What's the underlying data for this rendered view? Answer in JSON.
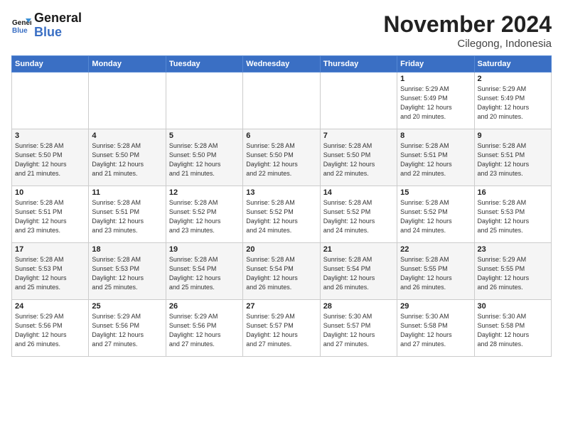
{
  "header": {
    "logo_line1": "General",
    "logo_line2": "Blue",
    "month": "November 2024",
    "location": "Cilegong, Indonesia"
  },
  "days_of_week": [
    "Sunday",
    "Monday",
    "Tuesday",
    "Wednesday",
    "Thursday",
    "Friday",
    "Saturday"
  ],
  "weeks": [
    [
      {
        "day": "",
        "info": ""
      },
      {
        "day": "",
        "info": ""
      },
      {
        "day": "",
        "info": ""
      },
      {
        "day": "",
        "info": ""
      },
      {
        "day": "",
        "info": ""
      },
      {
        "day": "1",
        "info": "Sunrise: 5:29 AM\nSunset: 5:49 PM\nDaylight: 12 hours\nand 20 minutes."
      },
      {
        "day": "2",
        "info": "Sunrise: 5:29 AM\nSunset: 5:49 PM\nDaylight: 12 hours\nand 20 minutes."
      }
    ],
    [
      {
        "day": "3",
        "info": "Sunrise: 5:28 AM\nSunset: 5:50 PM\nDaylight: 12 hours\nand 21 minutes."
      },
      {
        "day": "4",
        "info": "Sunrise: 5:28 AM\nSunset: 5:50 PM\nDaylight: 12 hours\nand 21 minutes."
      },
      {
        "day": "5",
        "info": "Sunrise: 5:28 AM\nSunset: 5:50 PM\nDaylight: 12 hours\nand 21 minutes."
      },
      {
        "day": "6",
        "info": "Sunrise: 5:28 AM\nSunset: 5:50 PM\nDaylight: 12 hours\nand 22 minutes."
      },
      {
        "day": "7",
        "info": "Sunrise: 5:28 AM\nSunset: 5:50 PM\nDaylight: 12 hours\nand 22 minutes."
      },
      {
        "day": "8",
        "info": "Sunrise: 5:28 AM\nSunset: 5:51 PM\nDaylight: 12 hours\nand 22 minutes."
      },
      {
        "day": "9",
        "info": "Sunrise: 5:28 AM\nSunset: 5:51 PM\nDaylight: 12 hours\nand 23 minutes."
      }
    ],
    [
      {
        "day": "10",
        "info": "Sunrise: 5:28 AM\nSunset: 5:51 PM\nDaylight: 12 hours\nand 23 minutes."
      },
      {
        "day": "11",
        "info": "Sunrise: 5:28 AM\nSunset: 5:51 PM\nDaylight: 12 hours\nand 23 minutes."
      },
      {
        "day": "12",
        "info": "Sunrise: 5:28 AM\nSunset: 5:52 PM\nDaylight: 12 hours\nand 23 minutes."
      },
      {
        "day": "13",
        "info": "Sunrise: 5:28 AM\nSunset: 5:52 PM\nDaylight: 12 hours\nand 24 minutes."
      },
      {
        "day": "14",
        "info": "Sunrise: 5:28 AM\nSunset: 5:52 PM\nDaylight: 12 hours\nand 24 minutes."
      },
      {
        "day": "15",
        "info": "Sunrise: 5:28 AM\nSunset: 5:52 PM\nDaylight: 12 hours\nand 24 minutes."
      },
      {
        "day": "16",
        "info": "Sunrise: 5:28 AM\nSunset: 5:53 PM\nDaylight: 12 hours\nand 25 minutes."
      }
    ],
    [
      {
        "day": "17",
        "info": "Sunrise: 5:28 AM\nSunset: 5:53 PM\nDaylight: 12 hours\nand 25 minutes."
      },
      {
        "day": "18",
        "info": "Sunrise: 5:28 AM\nSunset: 5:53 PM\nDaylight: 12 hours\nand 25 minutes."
      },
      {
        "day": "19",
        "info": "Sunrise: 5:28 AM\nSunset: 5:54 PM\nDaylight: 12 hours\nand 25 minutes."
      },
      {
        "day": "20",
        "info": "Sunrise: 5:28 AM\nSunset: 5:54 PM\nDaylight: 12 hours\nand 26 minutes."
      },
      {
        "day": "21",
        "info": "Sunrise: 5:28 AM\nSunset: 5:54 PM\nDaylight: 12 hours\nand 26 minutes."
      },
      {
        "day": "22",
        "info": "Sunrise: 5:28 AM\nSunset: 5:55 PM\nDaylight: 12 hours\nand 26 minutes."
      },
      {
        "day": "23",
        "info": "Sunrise: 5:29 AM\nSunset: 5:55 PM\nDaylight: 12 hours\nand 26 minutes."
      }
    ],
    [
      {
        "day": "24",
        "info": "Sunrise: 5:29 AM\nSunset: 5:56 PM\nDaylight: 12 hours\nand 26 minutes."
      },
      {
        "day": "25",
        "info": "Sunrise: 5:29 AM\nSunset: 5:56 PM\nDaylight: 12 hours\nand 27 minutes."
      },
      {
        "day": "26",
        "info": "Sunrise: 5:29 AM\nSunset: 5:56 PM\nDaylight: 12 hours\nand 27 minutes."
      },
      {
        "day": "27",
        "info": "Sunrise: 5:29 AM\nSunset: 5:57 PM\nDaylight: 12 hours\nand 27 minutes."
      },
      {
        "day": "28",
        "info": "Sunrise: 5:30 AM\nSunset: 5:57 PM\nDaylight: 12 hours\nand 27 minutes."
      },
      {
        "day": "29",
        "info": "Sunrise: 5:30 AM\nSunset: 5:58 PM\nDaylight: 12 hours\nand 27 minutes."
      },
      {
        "day": "30",
        "info": "Sunrise: 5:30 AM\nSunset: 5:58 PM\nDaylight: 12 hours\nand 28 minutes."
      }
    ]
  ]
}
